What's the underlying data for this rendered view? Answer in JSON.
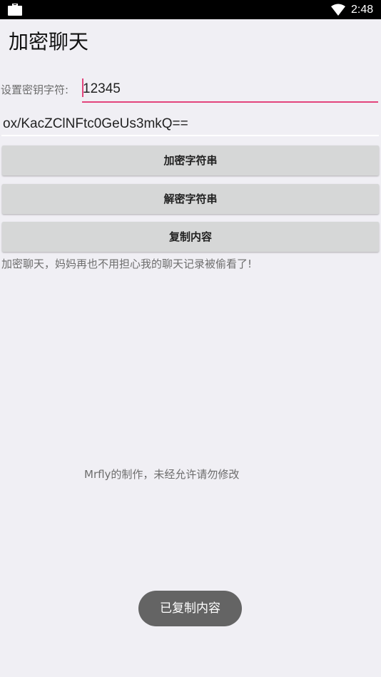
{
  "status_bar": {
    "time": "2:48",
    "left_icon": "briefcase-icon",
    "right_icon": "wifi-icon"
  },
  "app": {
    "title": "加密聊天"
  },
  "key_field": {
    "label": "设置密钥字符:",
    "value": "12345"
  },
  "cipher_field": {
    "value": "ox/KacZClNFtc0GeUs3mkQ=="
  },
  "buttons": {
    "encrypt": "加密字符串",
    "decrypt": "解密字符串",
    "copy": "复制内容"
  },
  "slogan": "加密聊天，妈妈再也不用担心我的聊天记录被偷看了!",
  "credit": "Mrfly的制作，未经允许请勿修改",
  "toast": "已复制内容",
  "colors": {
    "accent": "#e3447c",
    "button_bg": "#d6d7d7",
    "background": "#f0eff4",
    "toast_bg": "#646464"
  }
}
